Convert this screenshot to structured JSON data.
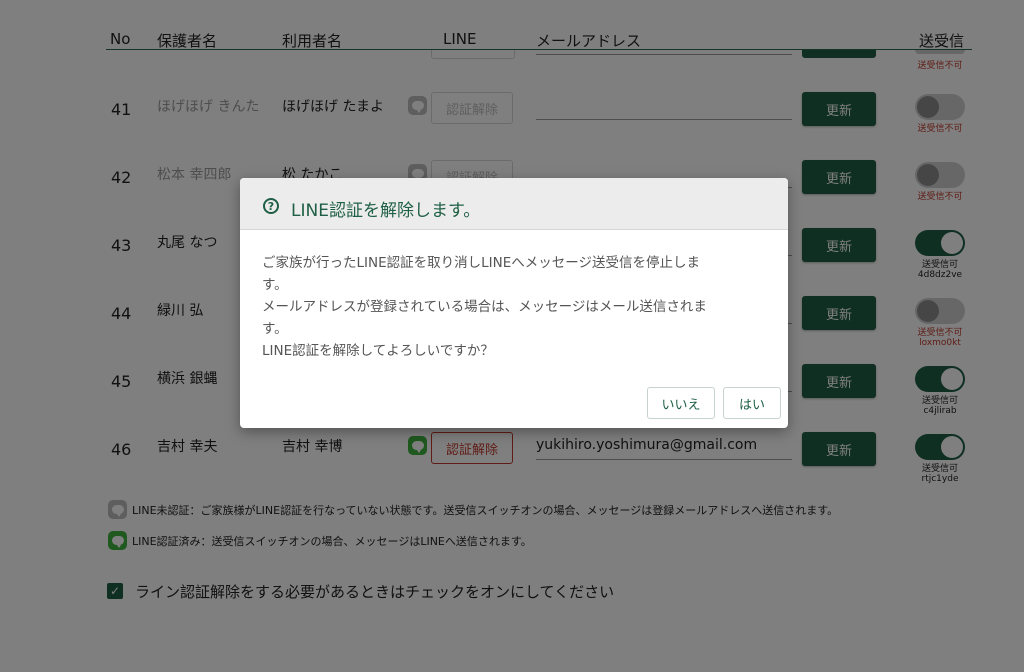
{
  "table": {
    "headers": {
      "no": "No",
      "guardian": "保護者名",
      "user": "利用者名",
      "line": "LINE",
      "email": "メールアドレス",
      "send": "送受信"
    },
    "top_partial_status": "送受信不可",
    "rows": [
      {
        "no": "41",
        "guardian": "ほげほげ きんた",
        "user": "ほげほげ たまよ",
        "line_auth": false,
        "deauth_label": "認証解除",
        "email": "",
        "update_label": "更新",
        "send_enabled": false,
        "send_status": "送受信不可",
        "code": ""
      },
      {
        "no": "42",
        "guardian": "松本 幸四郎",
        "user": "松 たかこ",
        "line_auth": false,
        "deauth_label": "認証解除",
        "email": "",
        "update_label": "更新",
        "send_enabled": false,
        "send_status": "送受信不可",
        "code": ""
      },
      {
        "no": "43",
        "guardian": "丸尾 なつ",
        "user": "",
        "line_auth": false,
        "deauth_label": "",
        "email": "",
        "update_label": "更新",
        "send_enabled": true,
        "send_status": "送受信可",
        "code": "4d8dz2ve"
      },
      {
        "no": "44",
        "guardian": "緑川 弘",
        "user": "",
        "line_auth": false,
        "deauth_label": "",
        "email": "",
        "update_label": "更新",
        "send_enabled": false,
        "send_status": "送受信不可",
        "code": "loxmo0kt"
      },
      {
        "no": "45",
        "guardian": "横浜 銀蝿",
        "user": "",
        "line_auth": false,
        "deauth_label": "",
        "email": "",
        "update_label": "更新",
        "send_enabled": true,
        "send_status": "送受信可",
        "code": "c4jlirab"
      },
      {
        "no": "46",
        "guardian": "吉村 幸夫",
        "user": "吉村 幸博",
        "line_auth": true,
        "deauth_label": "認証解除",
        "email": "yukihiro.yoshimura@gmail.com",
        "update_label": "更新",
        "send_enabled": true,
        "send_status": "送受信可",
        "code": "rtjc1yde"
      }
    ]
  },
  "legend": {
    "unauth": "LINE未認証：ご家族様がLINE認証を行なっていない状態です。送受信スイッチオンの場合、メッセージは登録メールアドレスへ送信されます。",
    "auth": "LINE認証済み：送受信スイッチオンの場合、メッセージはLINEへ送信されます。"
  },
  "checkbox": {
    "checked": true,
    "label": "ライン認証解除をする必要があるときはチェックをオンにしてください"
  },
  "modal": {
    "icon": "question-circle-icon",
    "title": "LINE認証を解除します。",
    "body_lines": [
      "ご家族が行ったLINE認証を取り消しLINEへメッセージ送受信を停止しま",
      "す。",
      "メールアドレスが登録されている場合は、メッセージはメール送信されま",
      "す。",
      "LINE認証を解除してよろしいですか？"
    ],
    "cancel_label": "いいえ",
    "confirm_label": "はい"
  },
  "colors": {
    "primary": "#1e5f45",
    "danger": "#c0392b",
    "line_green": "#3fb33f",
    "overlay": "rgba(0,0,0,0.5)"
  }
}
